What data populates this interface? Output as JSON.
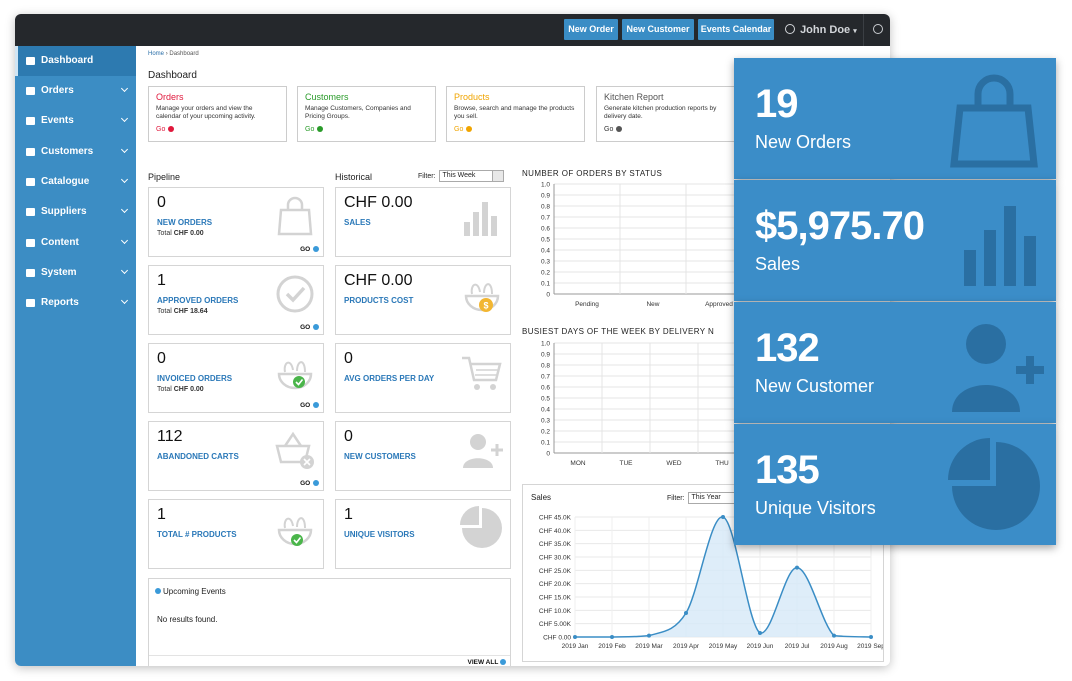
{
  "topbar": {
    "buttons": [
      "New Order",
      "New Customer",
      "Events Calendar"
    ],
    "user": "John Doe"
  },
  "sidebar": {
    "items": [
      {
        "label": "Dashboard",
        "active": true,
        "icon": "bar-chart-icon"
      },
      {
        "label": "Orders",
        "icon": "edit-icon"
      },
      {
        "label": "Events",
        "icon": "calendar-icon"
      },
      {
        "label": "Customers",
        "icon": "users-icon"
      },
      {
        "label": "Catalogue",
        "icon": "book-icon"
      },
      {
        "label": "Suppliers",
        "icon": "truck-icon"
      },
      {
        "label": "Content",
        "icon": "edit-icon"
      },
      {
        "label": "System",
        "icon": "dashboard-icon"
      },
      {
        "label": "Reports",
        "icon": "bar-chart-icon"
      }
    ]
  },
  "breadcrumb": {
    "home": "Home",
    "current": "Dashboard"
  },
  "page_title": "Dashboard",
  "quick_cards": [
    {
      "title": "Orders",
      "desc": "Manage your orders and view the calendar of your upcoming activity.",
      "go": "Go",
      "color": "#e0183c"
    },
    {
      "title": "Customers",
      "desc": "Manage Customers, Companies and Pricing Groups.",
      "go": "Go",
      "color": "#2a9b2a"
    },
    {
      "title": "Products",
      "desc": "Browse, search and manage the products you sell.",
      "go": "Go",
      "color": "#f0a400"
    },
    {
      "title": "Kitchen Report",
      "desc": "Generate kitchen production reports by delivery date.",
      "go": "Go",
      "color": "#555555"
    }
  ],
  "pipeline": {
    "title": "Pipeline",
    "cards": [
      {
        "value": "0",
        "label": "NEW ORDERS",
        "total_label": "Total",
        "total": "CHF 0.00",
        "go": "GO"
      },
      {
        "value": "1",
        "label": "APPROVED ORDERS",
        "total_label": "Total",
        "total": "CHF 18.64",
        "go": "GO"
      },
      {
        "value": "0",
        "label": "INVOICED ORDERS",
        "total_label": "Total",
        "total": "CHF 0.00",
        "go": "GO"
      },
      {
        "value": "112",
        "label": "ABANDONED CARTS",
        "go": "GO"
      },
      {
        "value": "1",
        "label": "TOTAL # PRODUCTS"
      }
    ]
  },
  "historical": {
    "title": "Historical",
    "filter_label": "Filter:",
    "filter_value": "This Week",
    "cards": [
      {
        "value": "CHF 0.00",
        "label": "SALES"
      },
      {
        "value": "CHF 0.00",
        "label": "PRODUCTS COST"
      },
      {
        "value": "0",
        "label": "AVG ORDERS PER DAY"
      },
      {
        "value": "0",
        "label": "NEW CUSTOMERS"
      },
      {
        "value": "1",
        "label": "UNIQUE VISITORS"
      }
    ]
  },
  "events": {
    "title": "Upcoming Events",
    "empty": "No results found.",
    "view_all": "VIEW ALL"
  },
  "chart_data": [
    {
      "type": "bar",
      "title": "NUMBER OF ORDERS BY STATUS",
      "categories": [
        "Pending",
        "New",
        "Approved"
      ],
      "values": [
        0,
        0,
        0
      ],
      "yticks": [
        "0",
        "0.1",
        "0.2",
        "0.3",
        "0.4",
        "0.5",
        "0.6",
        "0.7",
        "0.8",
        "0.9",
        "1.0"
      ],
      "ylim": [
        0,
        1.0
      ],
      "grid": true
    },
    {
      "type": "bar",
      "title": "BUSIEST DAYS OF THE WEEK BY DELIVERY N",
      "categories": [
        "MON",
        "TUE",
        "WED",
        "THU"
      ],
      "values": [
        0,
        0,
        0,
        0
      ],
      "yticks": [
        "0",
        "0.1",
        "0.2",
        "0.3",
        "0.4",
        "0.5",
        "0.6",
        "0.7",
        "0.8",
        "0.9",
        "1.0"
      ],
      "ylim": [
        0,
        1.0
      ],
      "grid": true
    },
    {
      "type": "area",
      "title": "Sales",
      "filter_label": "Filter:",
      "filter_value": "This Year",
      "x": [
        "2019 Jan",
        "2019 Feb",
        "2019 Mar",
        "2019 Apr",
        "2019 May",
        "2019 Jun",
        "2019 Jul",
        "2019 Aug",
        "2019 Sep"
      ],
      "values": [
        0,
        0,
        500,
        9000,
        45000,
        1500,
        26000,
        500,
        0
      ],
      "yticks": [
        "CHF 0.00",
        "CHF 5.00K",
        "CHF 10.0K",
        "CHF 15.0K",
        "CHF 20.0K",
        "CHF 25.0K",
        "CHF 30.0K",
        "CHF 35.0K",
        "CHF 40.0K",
        "CHF 45.0K"
      ],
      "ylim": [
        0,
        45000
      ],
      "grid": true,
      "color": "#3a8dc5"
    }
  ],
  "tiles": [
    {
      "value": "19",
      "label": "New Orders",
      "icon": "shopping-bag-icon"
    },
    {
      "value": "$5,975.70",
      "label": "Sales",
      "icon": "bar-chart-icon"
    },
    {
      "value": "132",
      "label": "New Customer",
      "icon": "add-user-icon"
    },
    {
      "value": "135",
      "label": "Unique Visitors",
      "icon": "pie-chart-icon"
    }
  ]
}
